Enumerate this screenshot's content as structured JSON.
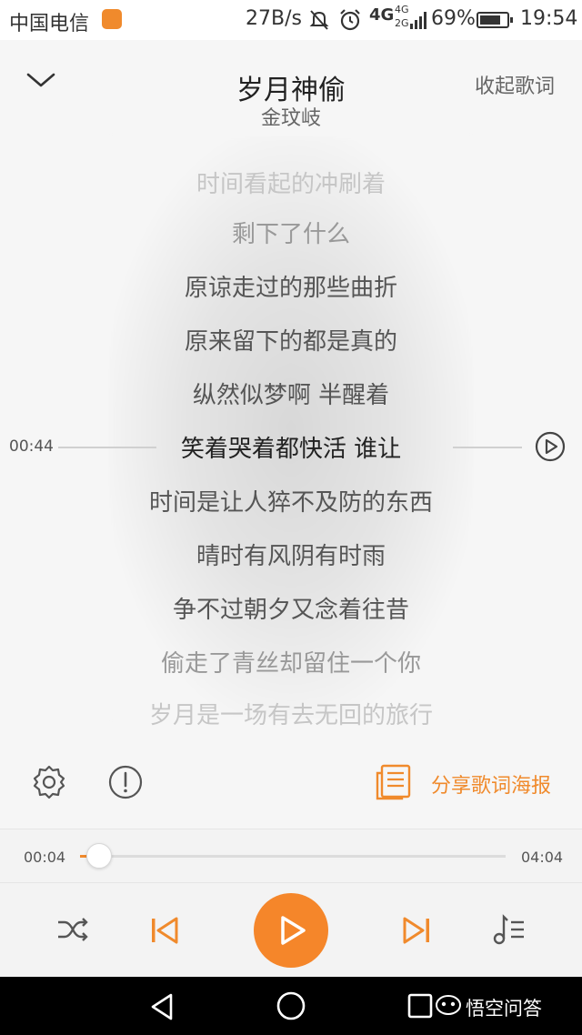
{
  "status_bar": {
    "carrier": "中国电信",
    "speed": "27B/s",
    "network": "4G",
    "network_small_top": "4G",
    "network_small_bottom": "2G",
    "battery": "69%",
    "time": "19:54"
  },
  "header": {
    "title": "岁月神偷",
    "artist": "金玟岐",
    "collapse_lyrics": "收起歌词"
  },
  "lyrics": {
    "lines": [
      "时间看起的冲刷着",
      "剩下了什么",
      "原谅走过的那些曲折",
      "原来留下的都是真的",
      "纵然似梦啊 半醒着",
      "笑着哭着都快活 谁让",
      "时间是让人猝不及防的东西",
      "晴时有风阴有时雨",
      "争不过朝夕又念着往昔",
      "偷走了青丝却留住一个你",
      "岁月是一场有去无回的旅行"
    ],
    "current_index": 5,
    "seek_time": "00:44"
  },
  "tools": {
    "share_label": "分享歌词海报"
  },
  "progress": {
    "current": "00:04",
    "total": "04:04",
    "fraction": 0.016
  },
  "watermark": "悟空问答",
  "colors": {
    "accent": "#f5862a",
    "background": "#f6f6f6"
  },
  "icons": {
    "collapse": "chevron-down-icon",
    "settings": "gear-icon",
    "report": "exclamation-circle-icon",
    "share": "poster-icon",
    "shuffle": "shuffle-icon",
    "previous": "skip-previous-icon",
    "play": "play-icon",
    "next": "skip-next-icon",
    "playlist": "playlist-icon"
  }
}
